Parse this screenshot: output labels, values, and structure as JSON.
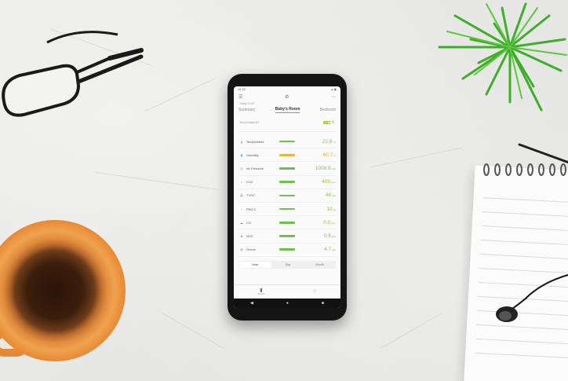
{
  "phone": {
    "status_left": "15:32",
    "status_right": "▴ ◉",
    "room_hint": "Today 14:07",
    "tabs": [
      {
        "label": "Summary"
      },
      {
        "label": "Baby's Room"
      },
      {
        "label": "Bedroom"
      }
    ],
    "device_name": "Vinol Indoor ID",
    "battery_value": "4.",
    "metrics": [
      {
        "label": "Temperature",
        "value": "22.8",
        "unit": "°C",
        "bar_color": "#6fbf4e",
        "icon": "thermometer-icon"
      },
      {
        "label": "Humidity",
        "value": "60.7",
        "unit": "%",
        "bar_color": "#e6b44a",
        "icon": "humidity-icon"
      },
      {
        "label": "Air Pressure",
        "value": "1008.8",
        "unit": "hPa",
        "bar_color": "#6fbf4e",
        "icon": "pressure-icon"
      },
      {
        "label": "CO2",
        "value": "400",
        "unit": "ppm",
        "bar_color": "#6fbf4e",
        "icon": "co2-icon"
      },
      {
        "label": "TVOC",
        "value": "44",
        "unit": "ppb",
        "bar_color": "#6fbf4e",
        "icon": "tvoc-icon"
      },
      {
        "label": "PM2.5",
        "value": "10",
        "unit": "μg",
        "bar_color": "#6fbf4e",
        "icon": "pm25-icon"
      },
      {
        "label": "CO",
        "value": "0.0",
        "unit": "ppm",
        "bar_color": "#6fbf4e",
        "icon": "co-icon"
      },
      {
        "label": "NO2",
        "value": "0.6",
        "unit": "ppb",
        "bar_color": "#6fbf4e",
        "icon": "no2-icon"
      },
      {
        "label": "Ozone",
        "value": "4.7",
        "unit": "ppb",
        "bar_color": "#6fbf4e",
        "icon": "ozone-icon"
      }
    ],
    "range_buttons": [
      {
        "label": "Hour"
      },
      {
        "label": "Day"
      },
      {
        "label": "Month"
      }
    ],
    "bottom_nav": [
      {
        "label": "Devices",
        "icon": "device-icon"
      },
      {
        "label": "",
        "icon": "lightbulb-icon"
      }
    ]
  }
}
